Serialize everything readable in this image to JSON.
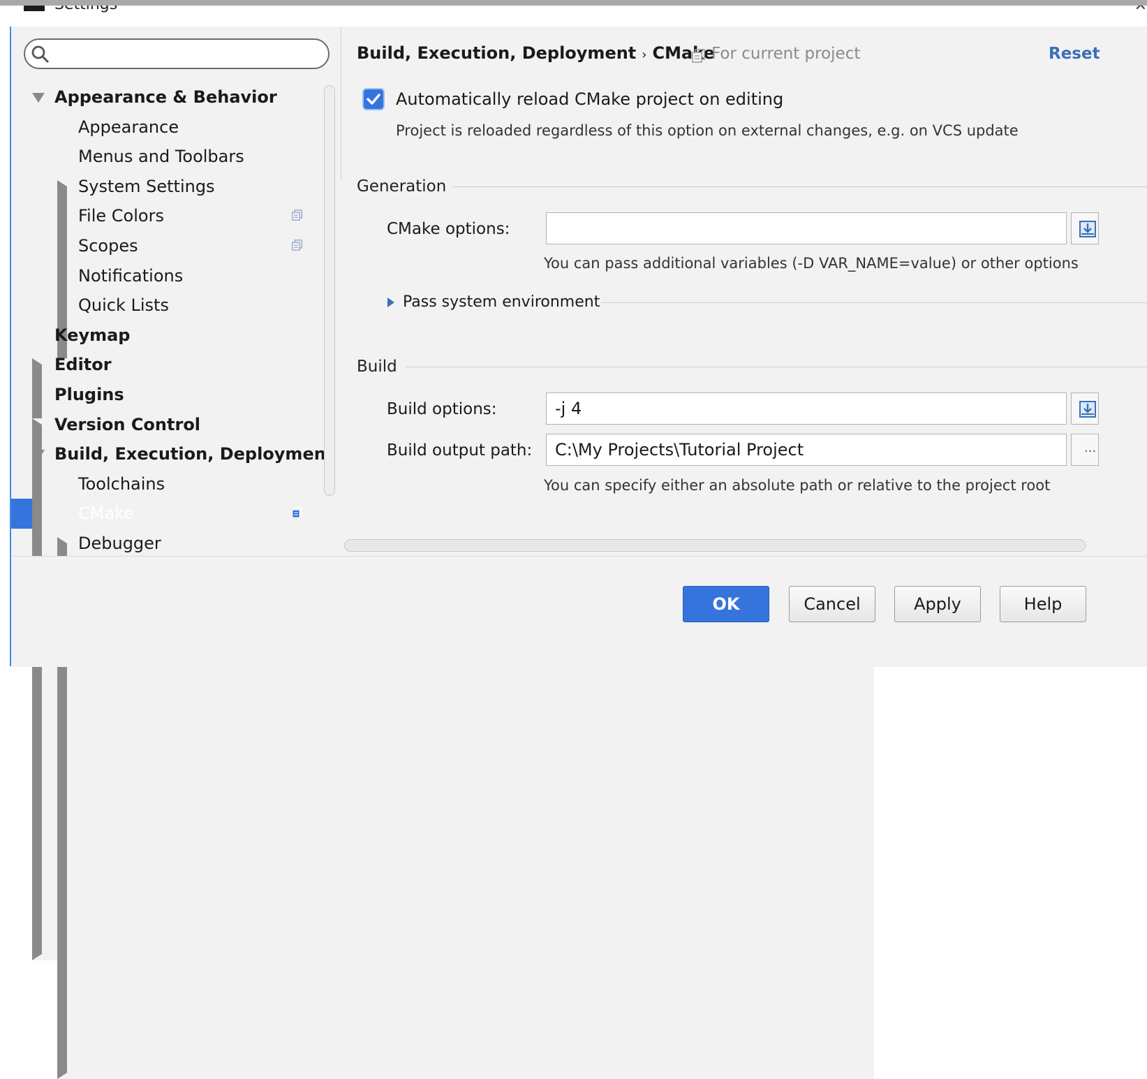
{
  "window": {
    "title": "Settings"
  },
  "search": {
    "value": "",
    "placeholder": ""
  },
  "tree": [
    {
      "label": "Appearance & Behavior",
      "bold": true,
      "arrow": "down",
      "level": 0,
      "copy": false
    },
    {
      "label": "Appearance",
      "bold": false,
      "arrow": "none",
      "level": 1,
      "copy": false
    },
    {
      "label": "Menus and Toolbars",
      "bold": false,
      "arrow": "none",
      "level": 1,
      "copy": false
    },
    {
      "label": "System Settings",
      "bold": false,
      "arrow": "right",
      "level": 1,
      "copy": false
    },
    {
      "label": "File Colors",
      "bold": false,
      "arrow": "none",
      "level": 1,
      "copy": true
    },
    {
      "label": "Scopes",
      "bold": false,
      "arrow": "none",
      "level": 1,
      "copy": true
    },
    {
      "label": "Notifications",
      "bold": false,
      "arrow": "none",
      "level": 1,
      "copy": false
    },
    {
      "label": "Quick Lists",
      "bold": false,
      "arrow": "none",
      "level": 1,
      "copy": false
    },
    {
      "label": "Keymap",
      "bold": true,
      "arrow": "none",
      "level": 0,
      "copy": false
    },
    {
      "label": "Editor",
      "bold": true,
      "arrow": "right",
      "level": 0,
      "copy": false
    },
    {
      "label": "Plugins",
      "bold": true,
      "arrow": "none",
      "level": 0,
      "copy": false
    },
    {
      "label": "Version Control",
      "bold": true,
      "arrow": "right",
      "level": 0,
      "copy": false
    },
    {
      "label": "Build, Execution, Deployment",
      "bold": true,
      "arrow": "down",
      "level": 0,
      "copy": false
    },
    {
      "label": "Toolchains",
      "bold": false,
      "arrow": "none",
      "level": 1,
      "copy": false
    },
    {
      "label": "CMake",
      "bold": false,
      "arrow": "none",
      "level": 1,
      "copy": true,
      "selected": true
    },
    {
      "label": "Debugger",
      "bold": false,
      "arrow": "right",
      "level": 1,
      "copy": false
    }
  ],
  "header": {
    "crumb_parent": "Build, Execution, Deployment",
    "crumb_sep": "›",
    "crumb_current": "CMake",
    "scope": "For current project",
    "reset": "Reset"
  },
  "auto_reload": {
    "checked": true,
    "label": "Automatically reload CMake project on editing",
    "hint": "Project is reloaded regardless of this option on external changes, e.g. on VCS update"
  },
  "generation": {
    "title": "Generation",
    "cmake_options_label": "CMake options:",
    "cmake_options_value": "",
    "cmake_options_hint": "You can pass additional variables (-D VAR_NAME=value) or other options",
    "pass_env_label": "Pass system environment"
  },
  "build": {
    "title": "Build",
    "build_options_label": "Build options:",
    "build_options_value": "-j 4",
    "output_path_label": "Build output path:",
    "output_path_value": "C:\\My Projects\\Tutorial Project",
    "output_path_hint": "You can specify either an absolute path or relative to the project root",
    "browse_label": "..."
  },
  "buttons": {
    "ok": "OK",
    "cancel": "Cancel",
    "apply": "Apply",
    "help": "Help"
  },
  "colors": {
    "accent": "#3574dd",
    "link": "#3a6fb8"
  }
}
